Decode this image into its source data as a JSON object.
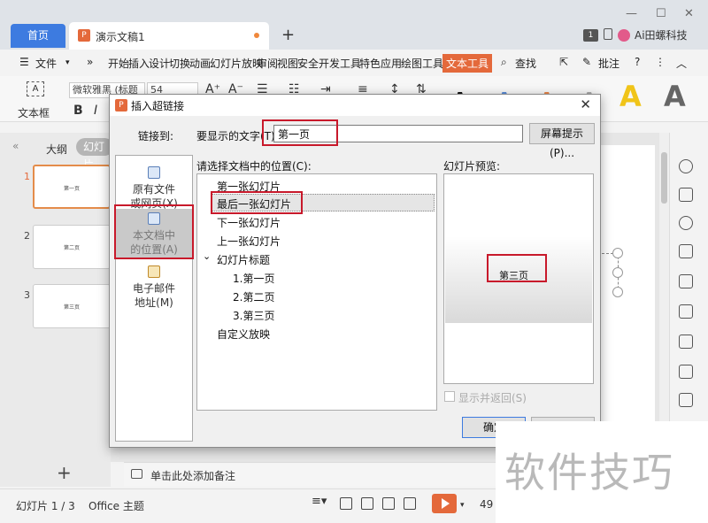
{
  "titlebar": {
    "home_tab": "首页",
    "doc_tab": "演示文稿1",
    "doc_logo": "P",
    "new_tab": "+",
    "badge": "1",
    "user": "Ai田螺科技"
  },
  "menubar": {
    "file": "文件",
    "items": [
      "开始",
      "插入",
      "设计",
      "切换",
      "动画",
      "幻灯片放映",
      "审阅",
      "视图",
      "安全",
      "开发工具",
      "特色应用",
      "绘图工具",
      "文本工具"
    ],
    "search": "查找",
    "comment": "批注",
    "help": "?"
  },
  "ribbon": {
    "textbox": "文本框",
    "font": "微软雅黑 (标题",
    "size": "54",
    "bold": "B",
    "italic": "I",
    "style_letter": "A"
  },
  "left_pane": {
    "outline_tab": "大纲",
    "slides_tab": "幻灯片",
    "thumbnails": [
      {
        "num": "1",
        "title": "第一页"
      },
      {
        "num": "2",
        "title": "第二页"
      },
      {
        "num": "3",
        "title": "第三页"
      }
    ],
    "add": "+"
  },
  "notes": {
    "placeholder": "单击此处添加备注"
  },
  "statusbar": {
    "slide_counter": "幻灯片 1 / 3",
    "theme": "Office 主题",
    "zoom": "49"
  },
  "dialog": {
    "title": "插入超链接",
    "logo": "P",
    "link_to_label": "链接到:",
    "display_text_label": "要显示的文字(T):",
    "display_text_value": "第一页",
    "screen_tip_button": "屏幕提示(P)...",
    "link_targets": [
      {
        "line1": "原有文件",
        "line2": "或网页(X)"
      },
      {
        "line1": "本文档中",
        "line2": "的位置(A)"
      },
      {
        "line1": "电子邮件",
        "line2": "地址(M)"
      }
    ],
    "location_label": "请选择文档中的位置(C):",
    "tree": {
      "first": "第一张幻灯片",
      "last": "最后一张幻灯片",
      "next": "下一张幻灯片",
      "prev": "上一张幻灯片",
      "titles": "幻灯片标题",
      "slide1": "1.第一页",
      "slide2": "2.第二页",
      "slide3": "3.第三页",
      "custom": "自定义放映",
      "expander": "⌄"
    },
    "preview_label": "幻灯片预览:",
    "preview_text": "第三页",
    "show_return": "显示并返回(S)",
    "ok_button": "确定"
  },
  "watermark": "软件技巧",
  "colors": {
    "accent": "#e4693b",
    "home_tab": "#3d7be0",
    "highlight_box": "#c8192b"
  }
}
